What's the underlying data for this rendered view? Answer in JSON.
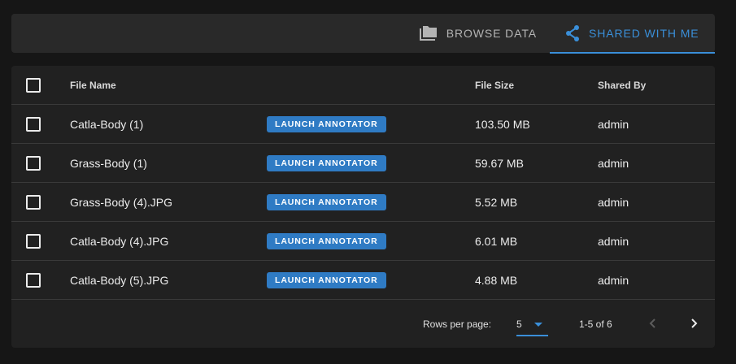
{
  "tabs": {
    "browse": {
      "label": "BROWSE DATA",
      "icon": "folder-icon"
    },
    "shared": {
      "label": "SHARED WITH ME",
      "icon": "share-icon"
    }
  },
  "table": {
    "headers": {
      "name": "File Name",
      "size": "File Size",
      "shared_by": "Shared By"
    },
    "launch_label": "LAUNCH ANNOTATOR",
    "rows": [
      {
        "name": "Catla-Body (1)",
        "size": "103.50 MB",
        "shared_by": "admin"
      },
      {
        "name": "Grass-Body (1)",
        "size": "59.67 MB",
        "shared_by": "admin"
      },
      {
        "name": "Grass-Body (4).JPG",
        "size": "5.52 MB",
        "shared_by": "admin"
      },
      {
        "name": "Catla-Body (4).JPG",
        "size": "6.01 MB",
        "shared_by": "admin"
      },
      {
        "name": "Catla-Body (5).JPG",
        "size": "4.88 MB",
        "shared_by": "admin"
      }
    ]
  },
  "pagination": {
    "rows_per_page_label": "Rows per page:",
    "rows_per_page": "5",
    "range": "1-5 of 6"
  },
  "colors": {
    "accent": "#3a8fd9",
    "launch_button": "#2f7bc4",
    "background": "#161616",
    "panel": "#212121"
  }
}
